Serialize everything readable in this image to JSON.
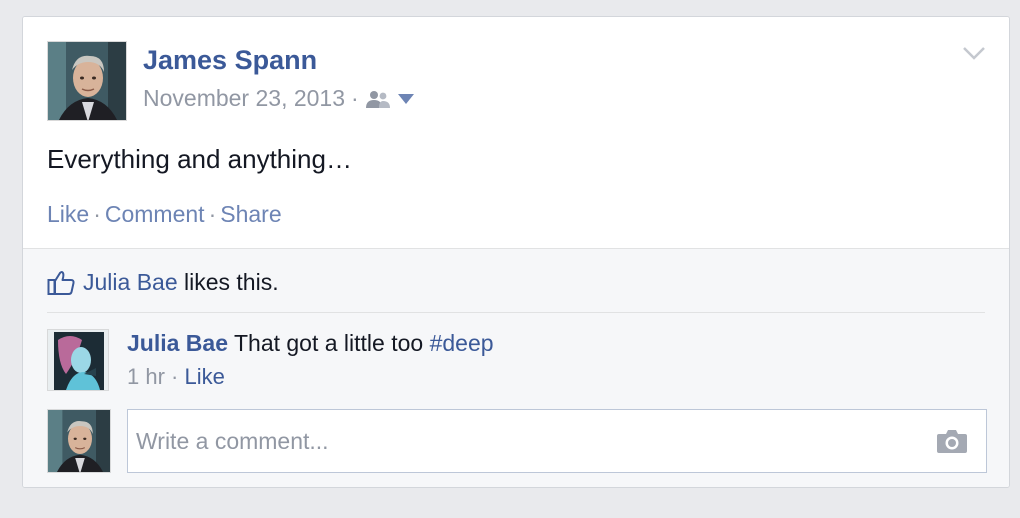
{
  "post": {
    "author": "James Spann",
    "date": "November 23, 2013",
    "meta_separator": "·",
    "audience_icon": "friends-icon",
    "menu_icon": "chevron-down-icon",
    "text": "Everything and anything…",
    "actions": {
      "like": "Like",
      "comment": "Comment",
      "share": "Share",
      "separator": "·"
    }
  },
  "likes": {
    "icon": "thumbs-up-icon",
    "liker": "Julia Bae",
    "suffix": " likes this."
  },
  "comments": [
    {
      "author": "Julia Bae",
      "text": " That got a little too ",
      "hashtag": "#deep",
      "time": "1 hr",
      "separator": " · ",
      "like": "Like"
    }
  ],
  "write_comment": {
    "placeholder": "Write a comment...",
    "camera_icon": "camera-icon"
  },
  "colors": {
    "link": "#3b5998",
    "action_link": "#6d84b4",
    "muted": "#9197a3",
    "background": "#e9eaed"
  }
}
